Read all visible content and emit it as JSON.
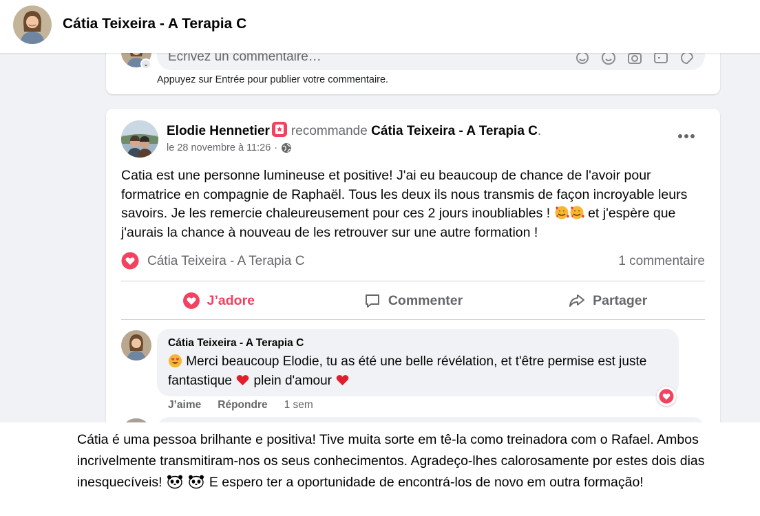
{
  "page_header": {
    "title": "Cátia Teixeira - A Terapia C"
  },
  "previous_card": {
    "comment_placeholder": "Écrivez un commentaire…",
    "hint": "Appuyez sur Entrée pour publier votre commentaire."
  },
  "post": {
    "author": "Elodie Hennetier",
    "verb": "recommande",
    "page": "Cátia Teixeira - A Terapia C",
    "date": "le 28 novembre à 11:26",
    "text_part1": "Catia est une personne lumineuse et positive! J'ai eu beaucoup de chance de l'avoir pour formatrice en compagnie de Raphaël. Tous les deux ils nous transmis de façon incroyable leurs savoirs. Je les remercie chaleureusement pour ces 2 jours inoubliables !",
    "text_part2": "et j'espère que j'aurais la chance à nouveau de les retrouver sur une autre formation !",
    "reaction_by": "Cátia Teixeira - A Terapia C",
    "comment_count": "1 commentaire",
    "actions": {
      "love": "J’adore",
      "comment": "Commenter",
      "share": "Partager"
    }
  },
  "comment": {
    "author": "Cátia Teixeira - A Terapia C",
    "text_part1": "Merci beaucoup Elodie, tu as été une belle révélation, et t'être permise est juste fantastique",
    "text_part2": "plein d'amour",
    "like": "J’aime",
    "reply": "Répondre",
    "time": "1 sem"
  },
  "translation": {
    "part1": "Cátia é uma pessoa brilhante e positiva! Tive muita sorte em tê-la como treinadora com o Rafael. Ambos incrivelmente transmitiram-nos os seus conhecimentos. Agradeço-lhes calorosamente por estes dois dias inesquecíveis!",
    "part2": "E espero ter a oportunidade de encontrá-los de novo em outra formação!"
  },
  "icons": {
    "recommend": "recommend-star-icon",
    "globe": "globe-icon",
    "more": "more-options-icon",
    "love_reaction": "heart-reaction-icon",
    "comment": "comment-icon",
    "share": "share-icon"
  },
  "colors": {
    "accent_love": "#f3425f",
    "text_secondary": "#65676b",
    "background": "#f0f2f5"
  }
}
